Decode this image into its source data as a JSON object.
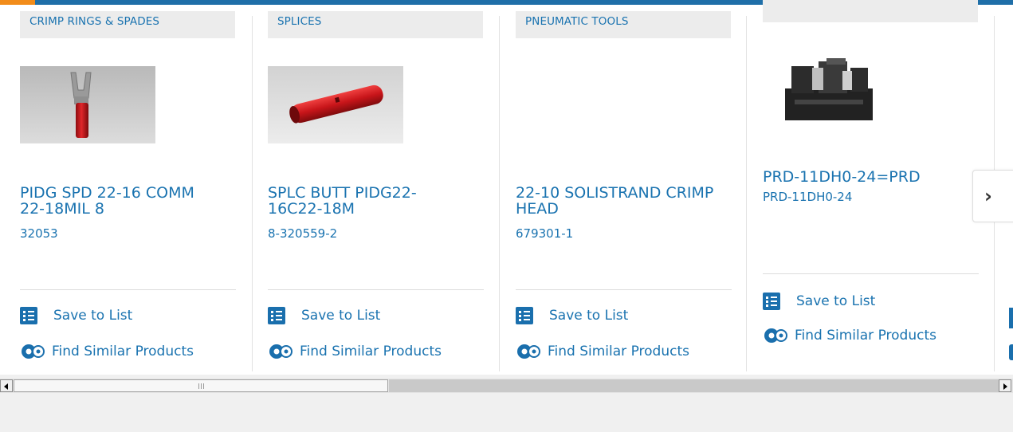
{
  "products": [
    {
      "category": "CRIMP RINGS & SPADES",
      "title": "PIDG SPD 22-16 COMM 22-18MIL 8",
      "part_number": "32053",
      "save_label": "Save to List",
      "similar_label": "Find Similar Products",
      "image": "red-spade-terminal"
    },
    {
      "category": "SPLICES",
      "title": "SPLC BUTT PIDG22-16C22-18M",
      "part_number": "8-320559-2",
      "save_label": "Save to List",
      "similar_label": "Find Similar Products",
      "image": "red-butt-splice"
    },
    {
      "category": "PNEUMATIC TOOLS",
      "title": "22-10 SOLISTRAND CRIMP HEAD",
      "part_number": "679301-1",
      "save_label": "Save to List",
      "similar_label": "Find Similar Products",
      "image": "none"
    },
    {
      "category": "",
      "title": "PRD-11DH0-24=PRD",
      "part_number": "PRD-11DH0-24",
      "save_label": "Save to List",
      "similar_label": "Find Similar Products",
      "image": "power-relay"
    }
  ],
  "carousel": {
    "next_icon": "chevron-right-icon",
    "next_glyph": "›"
  },
  "colors": {
    "link": "#1a73b0",
    "icon": "#1a6fad",
    "topbar": "#1f6fa8",
    "accent": "#f28c1a"
  },
  "scrollbar": {
    "left_icon": "triangle-left-icon",
    "right_icon": "triangle-right-icon"
  }
}
